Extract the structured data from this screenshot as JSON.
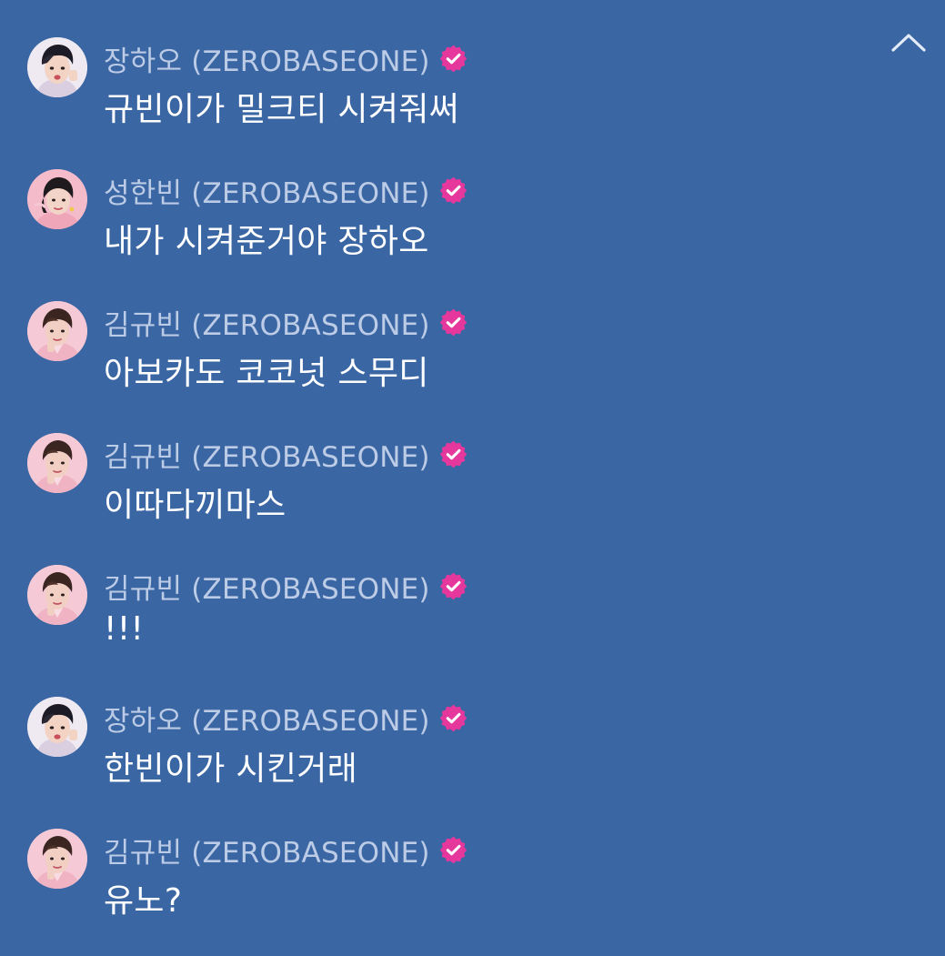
{
  "colors": {
    "background": "#3a66a3",
    "author_text": "#bccbe6",
    "message_text": "#ffffff",
    "verified_badge": "#e6389c"
  },
  "header": {
    "collapse_icon": "chevron-up-icon"
  },
  "messages": [
    {
      "author": "장하오 (ZEROBASEONE)",
      "text": "규빈이가 밀크티 시켜줘써",
      "avatar": "avatar-zhang-hao",
      "verified": true
    },
    {
      "author": "성한빈 (ZEROBASEONE)",
      "text": "내가 시켜준거야 장하오",
      "avatar": "avatar-sung-hanbin",
      "verified": true
    },
    {
      "author": "김규빈 (ZEROBASEONE)",
      "text": "아보카도 코코넛 스무디",
      "avatar": "avatar-kim-gyuvin",
      "verified": true
    },
    {
      "author": "김규빈 (ZEROBASEONE)",
      "text": "이따다끼마스",
      "avatar": "avatar-kim-gyuvin",
      "verified": true
    },
    {
      "author": "김규빈 (ZEROBASEONE)",
      "text": "!!!",
      "avatar": "avatar-kim-gyuvin",
      "verified": true
    },
    {
      "author": "장하오 (ZEROBASEONE)",
      "text": "한빈이가 시킨거래",
      "avatar": "avatar-zhang-hao",
      "verified": true
    },
    {
      "author": "김규빈 (ZEROBASEONE)",
      "text": "유노?",
      "avatar": "avatar-kim-gyuvin",
      "verified": true
    }
  ]
}
